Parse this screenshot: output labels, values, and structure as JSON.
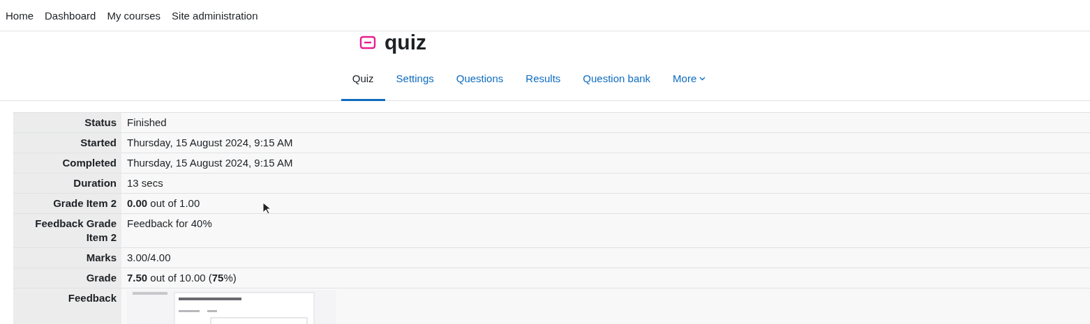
{
  "navbar": {
    "items": [
      "Home",
      "Dashboard",
      "My courses",
      "Site administration"
    ]
  },
  "heading": {
    "title": "quiz"
  },
  "tabs": [
    {
      "label": "Quiz",
      "selected": true
    },
    {
      "label": "Settings",
      "selected": false
    },
    {
      "label": "Questions",
      "selected": false
    },
    {
      "label": "Results",
      "selected": false
    },
    {
      "label": "Question bank",
      "selected": false
    },
    {
      "label": "More",
      "selected": false,
      "kind": "dropdown"
    }
  ],
  "summary": [
    {
      "label": "Status",
      "value": "Finished"
    },
    {
      "label": "Started",
      "value": "Thursday, 15 August 2024, 9:15 AM"
    },
    {
      "label": "Completed",
      "value": "Thursday, 15 August 2024, 9:15 AM"
    },
    {
      "label": "Duration",
      "value": "13 secs"
    },
    {
      "label": "Grade Item 2",
      "value": "**0.00** out of 1.00"
    },
    {
      "label": "Feedback Grade Item 2",
      "value": "Feedback for 40%"
    },
    {
      "label": "Marks",
      "value": "3.00/4.00"
    },
    {
      "label": "Grade",
      "value": "**7.50** out of 10.00 (**75**%)"
    },
    {
      "label": "Feedback",
      "kind": "picture"
    }
  ]
}
